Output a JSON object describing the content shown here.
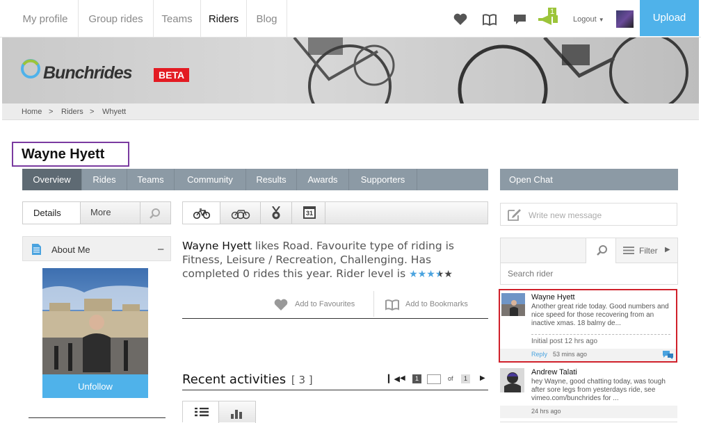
{
  "nav": {
    "tabs": [
      {
        "label": "My profile"
      },
      {
        "label": "Group rides"
      },
      {
        "label": "Teams"
      },
      {
        "label": "Riders"
      },
      {
        "label": "Blog"
      }
    ],
    "notification_count": "1",
    "logout_label": "Logout",
    "upload_label": "Upload"
  },
  "brand": {
    "name": "Bunchrides",
    "badge": "BETA"
  },
  "breadcrumb": {
    "items": [
      "Home",
      "Riders",
      "Whyett"
    ],
    "separator": ">"
  },
  "profile": {
    "name": "Wayne Hyett",
    "tabs": [
      "Overview",
      "Rides",
      "Teams",
      "Community",
      "Results",
      "Awards",
      "Supporters"
    ],
    "side_tabs": {
      "details": "Details",
      "more": "More"
    },
    "about_title": "About Me",
    "collapse_symbol": "–",
    "unfollow_label": "Unfollow",
    "bio_name": "Wayne Hyett",
    "bio_text": " likes Road. Favourite type of riding is Fitness, Leisure / Recreation, Challenging. Has completed 0 rides this year. Rider level is ",
    "rider_level": 3.5,
    "add_favourites": "Add to Favourites",
    "add_bookmarks": "Add to Bookmarks",
    "calendar_day": "31"
  },
  "activities": {
    "title": "Recent activities",
    "count": "3",
    "page": "1",
    "of_label": "of",
    "total_pages": "1"
  },
  "chat": {
    "open_label": "Open Chat",
    "write_placeholder": "Write new message",
    "filter_label": "Filter",
    "search_placeholder": "Search rider",
    "messages": [
      {
        "author": "Wayne Hyett",
        "text": "Another great ride today. Good numbers and nice speed for those recovering from an inactive xmas. 18 balmy de...",
        "meta": "Initial post 12 hrs ago",
        "reply_label": "Reply",
        "reply_time": "53 mins ago"
      },
      {
        "author": "Andrew Talati",
        "text": "hey Wayne, good chatting today, was tough after sore legs from yesterdays ride, see vimeo.com/bunchrides for ...",
        "meta": "24 hrs ago"
      }
    ]
  },
  "colors": {
    "accent": "#4fb2ea",
    "nav_gray": "#8c9aa5",
    "active_tab": "#5e6a73",
    "highlight_border": "#d0202a",
    "title_border": "#7a3aa0",
    "badge_red": "#e31b23",
    "notify_green": "#9cc43a"
  }
}
